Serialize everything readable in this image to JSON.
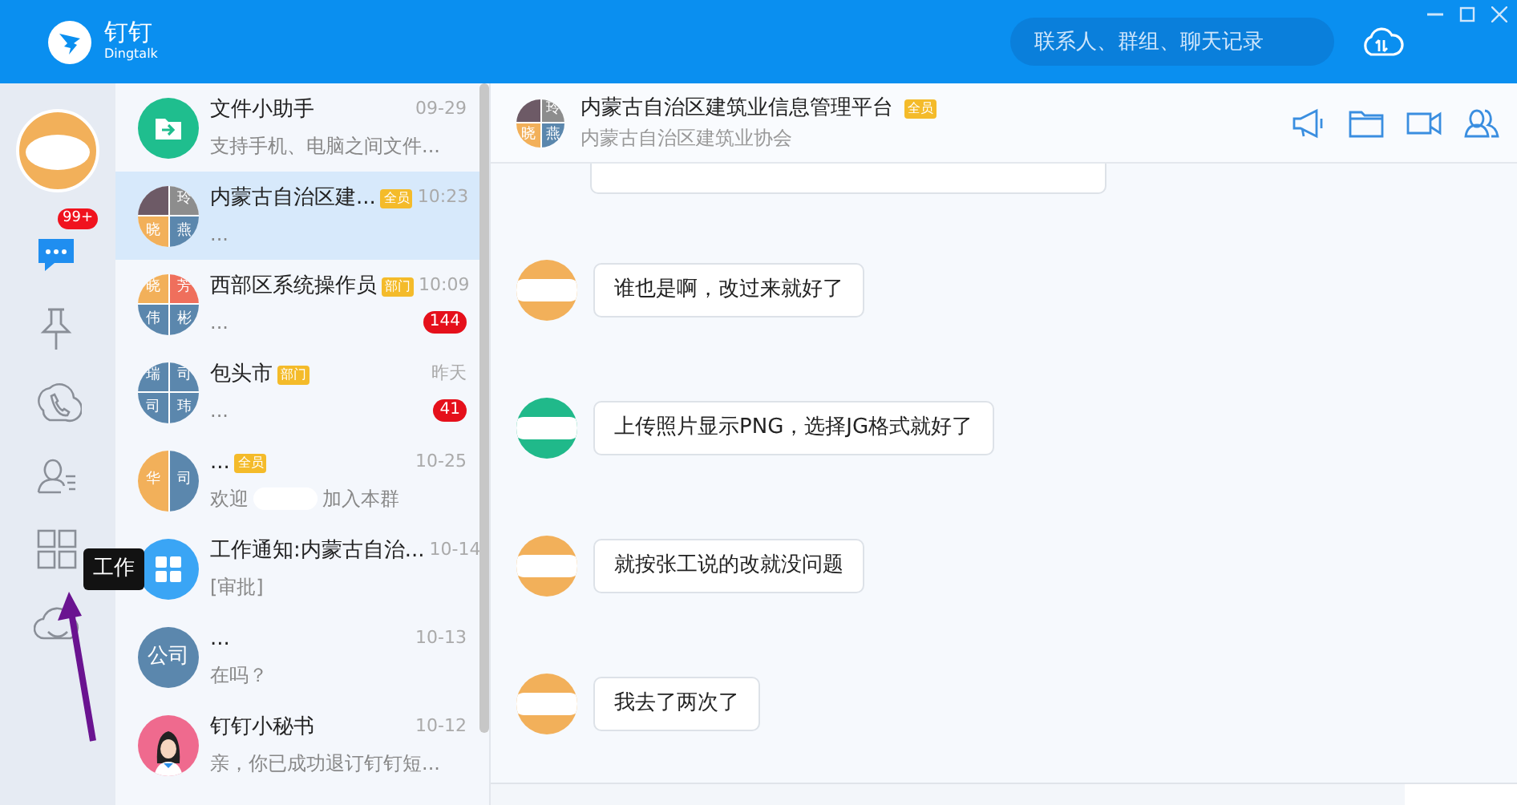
{
  "app": {
    "name": "钉钉",
    "subtitle": "Dingtalk"
  },
  "search": {
    "placeholder": "联系人、群组、聊天记录"
  },
  "rail": {
    "items": [
      {
        "kind": "chat",
        "badge": "99+",
        "selected": true
      },
      {
        "kind": "pin",
        "selected": false
      },
      {
        "kind": "phone",
        "selected": false
      },
      {
        "kind": "contacts",
        "selected": false
      },
      {
        "kind": "apps",
        "selected": false,
        "tooltip": "工作"
      },
      {
        "kind": "cloud",
        "selected": false
      }
    ]
  },
  "conversations": [
    {
      "title": "文件小助手",
      "time": "09-29",
      "preview": [
        "支持手机、电脑之间文件..."
      ],
      "selected": false,
      "avatar": {
        "kind": "file",
        "color": "#1fbe8e"
      }
    },
    {
      "title": "内蒙古自治区建...",
      "tag": "全员",
      "time": "10:23",
      "preview": [
        "..."
      ],
      "selected": true,
      "avatar": {
        "kind": "quad",
        "cells": [
          {
            "color": "#6d5a66"
          },
          {
            "label": "玲",
            "color": "#8d8d8d"
          },
          {
            "label": "晓",
            "color": "#f2b05a"
          },
          {
            "label": "燕",
            "color": "#5b87ad"
          }
        ]
      }
    },
    {
      "title": "西部区系统操作员",
      "tag": "部门",
      "time": "10:09",
      "preview": [
        "..."
      ],
      "unread": "144",
      "selected": false,
      "avatar": {
        "kind": "quad",
        "cells": [
          {
            "label": "晓",
            "color": "#f2b05a"
          },
          {
            "label": "芳",
            "color": "#ef6f5c"
          },
          {
            "label": "伟",
            "color": "#5b87ad"
          },
          {
            "label": "彬",
            "color": "#5b87ad"
          }
        ]
      }
    },
    {
      "title": "包头市",
      "tag": "部门",
      "time": "昨天",
      "preview": [
        "..."
      ],
      "unread": "41",
      "selected": false,
      "avatar": {
        "kind": "quad",
        "cells": [
          {
            "label": "瑞",
            "color": "#5b87ad"
          },
          {
            "label": "司",
            "color": "#5b87ad"
          },
          {
            "label": "司",
            "color": "#5b87ad"
          },
          {
            "label": "玮",
            "color": "#5b87ad"
          }
        ]
      }
    },
    {
      "title": "...",
      "tag": "全员",
      "time": "10-25",
      "preview": [
        "欢迎",
        "加入本群"
      ],
      "selected": false,
      "avatar": {
        "kind": "split",
        "cells": [
          {
            "label": "华",
            "color": "#f2b05a"
          },
          {
            "label": "司",
            "color": "#5b87ad"
          }
        ]
      }
    },
    {
      "title": "工作通知:内蒙古自治...",
      "time": "10-14",
      "preview": [
        "[审批]"
      ],
      "selected": false,
      "avatar": {
        "kind": "work",
        "color": "#3aa5f5"
      }
    },
    {
      "title": "...",
      "time": "10-13",
      "preview": [
        "在吗？"
      ],
      "selected": false,
      "avatar": {
        "kind": "text",
        "label": "公司",
        "color": "#5b87ad"
      }
    },
    {
      "title": "钉钉小秘书",
      "time": "10-12",
      "preview": [
        "亲，你已成功退订钉钉短..."
      ],
      "selected": false,
      "avatar": {
        "kind": "person",
        "color": "#ef6a8e"
      }
    }
  ],
  "chat": {
    "title": "内蒙古自治区建筑业信息管理平台",
    "tag": "全员",
    "subtitle": "内蒙古自治区建筑业协会",
    "avatar": {
      "kind": "quad",
      "cells": [
        {
          "color": "#6d5a66"
        },
        {
          "label": "玲",
          "color": "#8d8d8d"
        },
        {
          "label": "晓",
          "color": "#f2b05a"
        },
        {
          "label": "燕",
          "color": "#5b87ad"
        }
      ]
    },
    "messages": [
      {
        "text": "谁也是啊，改过来就好了",
        "avatar": {
          "color": "#f2b05a"
        }
      },
      {
        "text": "上传照片显示PNG，选择JG格式就好了",
        "avatar": {
          "color": "#20b98a"
        }
      },
      {
        "text": "就按张工说的改就没问题",
        "avatar": {
          "color": "#f2b05a"
        }
      },
      {
        "text": "我去了两次了",
        "avatar": {
          "color": "#f2b05a"
        }
      }
    ]
  }
}
